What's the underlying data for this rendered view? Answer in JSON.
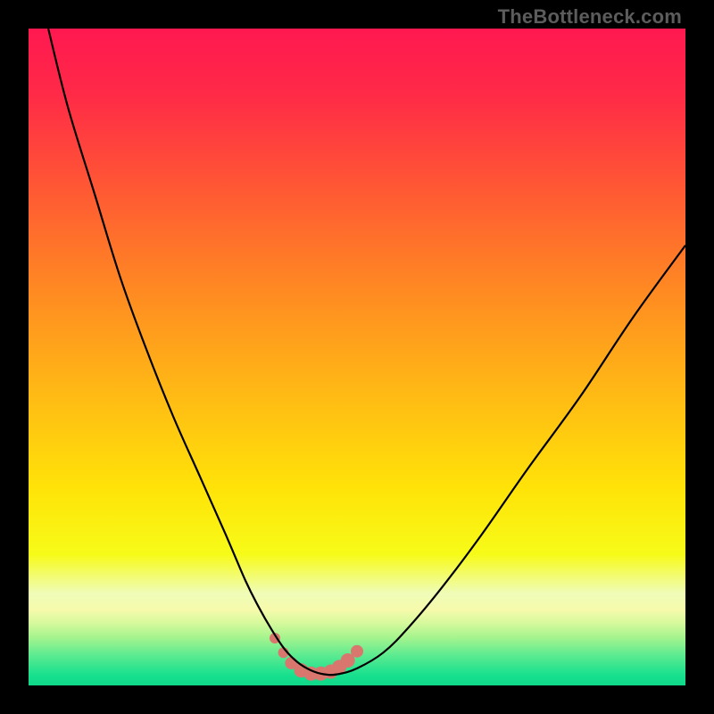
{
  "watermark": "TheBottleneck.com",
  "colors": {
    "black": "#000000",
    "gradient_stops": [
      {
        "offset": 0.0,
        "color": "#ff1850"
      },
      {
        "offset": 0.1,
        "color": "#ff2a47"
      },
      {
        "offset": 0.25,
        "color": "#ff5a33"
      },
      {
        "offset": 0.4,
        "color": "#ff8a22"
      },
      {
        "offset": 0.55,
        "color": "#ffb815"
      },
      {
        "offset": 0.7,
        "color": "#ffe308"
      },
      {
        "offset": 0.8,
        "color": "#f7fb18"
      },
      {
        "offset": 0.86,
        "color": "#effcb8"
      },
      {
        "offset": 0.885,
        "color": "#f6faab"
      },
      {
        "offset": 0.905,
        "color": "#d6f99c"
      },
      {
        "offset": 0.927,
        "color": "#a5f48e"
      },
      {
        "offset": 0.955,
        "color": "#5aea90"
      },
      {
        "offset": 0.985,
        "color": "#16e08e"
      },
      {
        "offset": 1.0,
        "color": "#10d88a"
      }
    ],
    "curve": "#000000",
    "marker_fill": "#d9766d",
    "marker_stroke": "#c65b52"
  },
  "chart_data": {
    "type": "line",
    "title": "",
    "xlabel": "",
    "ylabel": "",
    "xlim": [
      0,
      100
    ],
    "ylim": [
      0,
      100
    ],
    "series": [
      {
        "name": "bottleneck-curve",
        "x": [
          3,
          6,
          10,
          14,
          18,
          22,
          26,
          30,
          33,
          35,
          37,
          39,
          41,
          43,
          45,
          47,
          50,
          54,
          58,
          63,
          69,
          76,
          84,
          92,
          100
        ],
        "y": [
          100,
          88,
          75,
          62,
          51,
          41,
          32,
          23,
          16,
          12,
          8.5,
          5.5,
          3.5,
          2.3,
          1.7,
          1.7,
          2.6,
          5,
          9,
          15,
          23,
          33,
          44,
          56,
          67
        ]
      }
    ],
    "markers": {
      "name": "highlight-segment",
      "x": [
        37.5,
        38.8,
        40.0,
        41.5,
        43.0,
        44.5,
        46.0,
        47.3,
        48.6,
        50.0
      ],
      "y": [
        7.2,
        5.0,
        3.4,
        2.3,
        1.8,
        1.8,
        2.1,
        2.8,
        3.8,
        5.2
      ],
      "radius": [
        6,
        6,
        7,
        8,
        8,
        8,
        8,
        8,
        8,
        7
      ]
    }
  }
}
